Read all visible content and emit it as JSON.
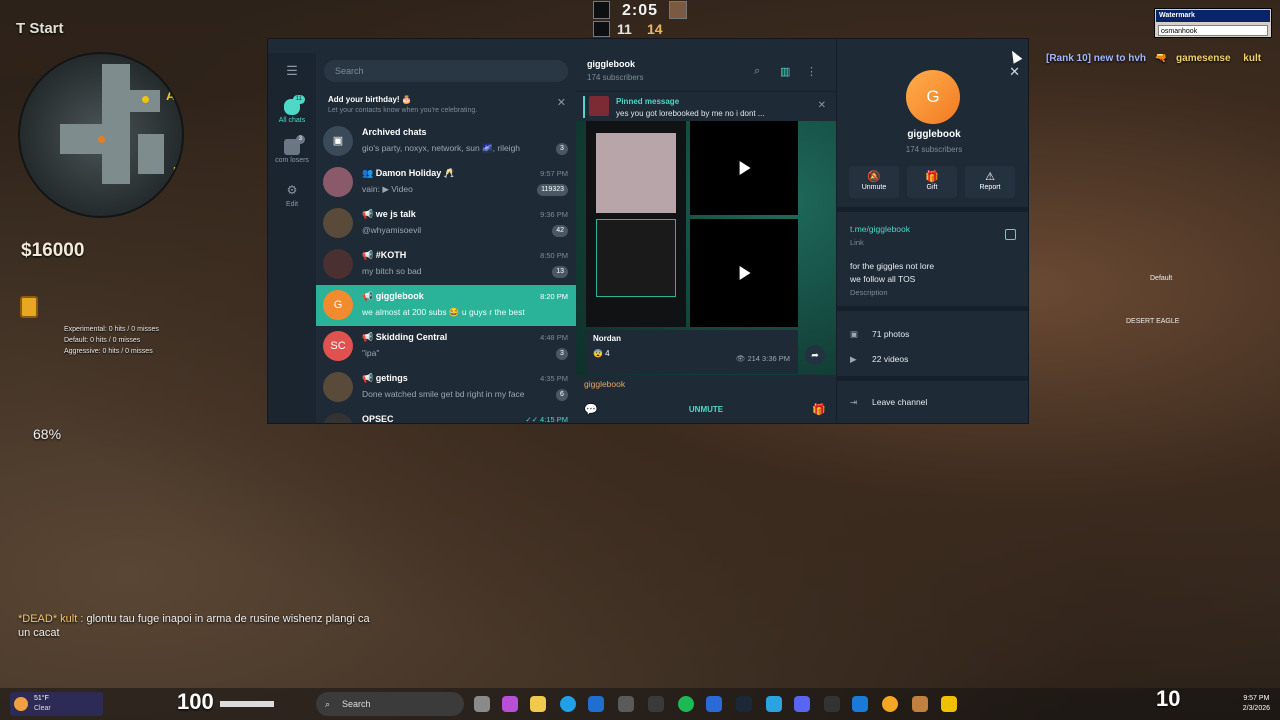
{
  "hud": {
    "team": "T Start",
    "money": "$16000",
    "timer": "2:05",
    "score_ct": "11",
    "score_t": "14",
    "stats": [
      "Experimental: 0 hits / 0 misses",
      "Default: 0 hits / 0 misses",
      "Aggressive: 0 hits / 0 misses"
    ],
    "percent": "68%",
    "health": "100",
    "ammo": "10",
    "chat_dead": "*DEAD* kult :",
    "chat_msg": "glontu tau fuge inapoi in arma de rusine wishenz plangi ca un cacat",
    "killfeed_a": "[Rank 10] new to hvh",
    "killfeed_b": "gamesense",
    "killfeed_c": "kult",
    "weapon_label": "Default",
    "weapon_name": "DESERT EAGLE",
    "radar_sites": [
      "A",
      "B"
    ]
  },
  "watermark": {
    "title": "Watermark",
    "value": "osmanhook"
  },
  "telegram": {
    "rail": [
      {
        "label": "All chats",
        "badge": "11",
        "active": true
      },
      {
        "label": "com losers",
        "badge": "3",
        "active": false
      },
      {
        "label": "Edit",
        "badge": "",
        "active": false
      }
    ],
    "search_placeholder": "Search",
    "birthday": {
      "title": "Add your birthday! 🎂",
      "sub": "Let your contacts know when you're celebrating."
    },
    "chats": [
      {
        "avatar": "▣",
        "name": "Archived chats",
        "msg": "gio's party, noxyx, network, sun 🌌, rileigh",
        "time": "",
        "badge": "3",
        "color": "#3b4a58"
      },
      {
        "avatar": "",
        "name": "👥 Damon Holiday 🥂",
        "msg": "vain: ▶ Video",
        "time": "9:57 PM",
        "badge": "119323",
        "color": "#8a5a6a"
      },
      {
        "avatar": "",
        "name": "📢 we js talk",
        "msg": "@whyamisoevil",
        "time": "9:36 PM",
        "badge": "42",
        "color": "#5a4a3a"
      },
      {
        "avatar": "",
        "name": "📢 #KOTH",
        "msg": "my bitch so bad",
        "time": "8:50 PM",
        "badge": "13",
        "color": "#4a3030"
      },
      {
        "avatar": "G",
        "name": "📢 gigglebook",
        "msg": "we almost at 200 subs 😂 u guys r the best",
        "time": "8:20 PM",
        "badge": "",
        "color": "#f28a2e",
        "active": true
      },
      {
        "avatar": "SC",
        "name": "📢 Skidding Central",
        "msg": "\"ipa\"",
        "time": "4:48 PM",
        "badge": "3",
        "color": "#e0524f"
      },
      {
        "avatar": "",
        "name": "📢 getings",
        "msg": "Done watched smile get bd right in my face",
        "time": "4:35 PM",
        "badge": "6",
        "color": "#5a4a3a"
      },
      {
        "avatar": "",
        "name": "OPSEC",
        "msg": "",
        "time": "✓✓ 4:15 PM",
        "badge": "",
        "color": "#333"
      }
    ],
    "channel": {
      "title": "gigglebook",
      "subs": "174 subscribers",
      "pinned_title": "Pinned message",
      "pinned_text": "yes you got lorebooked by me  no i dont ...",
      "author": "Nordan",
      "reaction": "😨 4",
      "views": "👁 214  3:36 PM",
      "preview": "gigglebook",
      "unmute": "UNMUTE"
    },
    "info": {
      "avatar": "G",
      "name": "gigglebook",
      "subs": "174 subscribers",
      "actions": [
        "Unmute",
        "Gift",
        "Report"
      ],
      "link": "t.me/gigglebook",
      "link_label": "Link",
      "desc_line1": "for the giggles not lore",
      "desc_line2": "we follow all TOS",
      "desc_label": "Description",
      "photos": "71 photos",
      "videos": "22 videos",
      "leave": "Leave channel"
    }
  },
  "taskbar": {
    "temp": "51°F",
    "cond": "Clear",
    "search": "Search",
    "time": "9:57 PM",
    "date": "2/3/2026"
  }
}
